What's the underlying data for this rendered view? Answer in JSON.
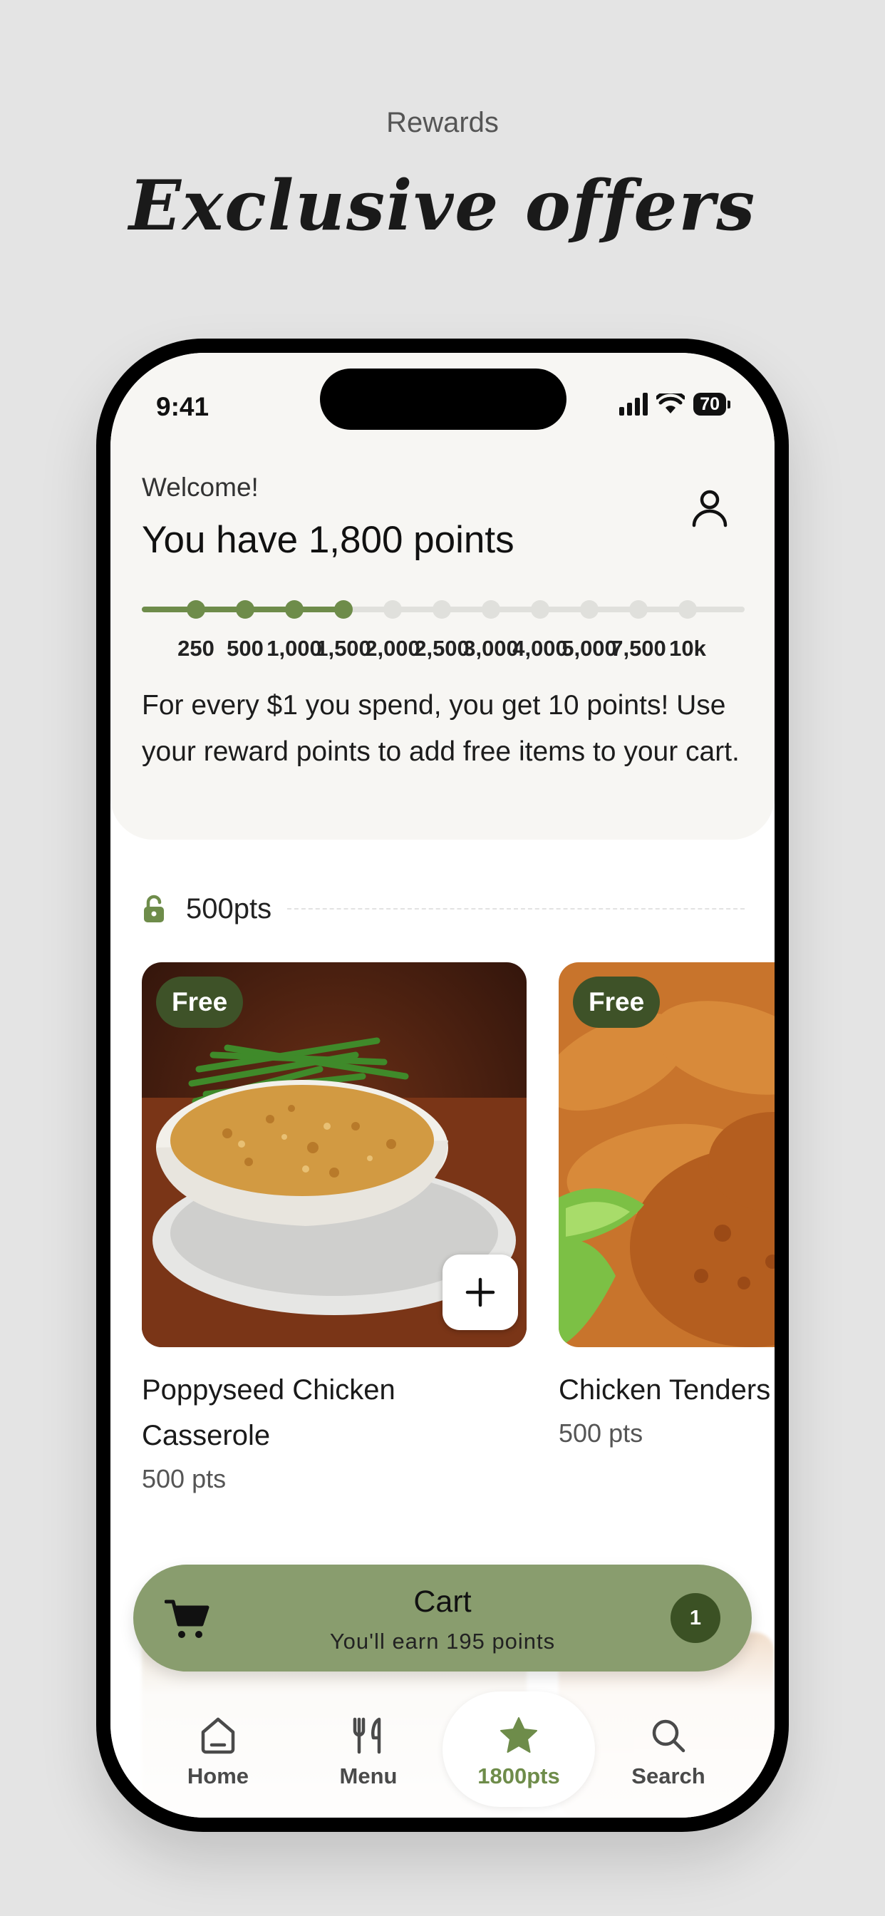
{
  "page": {
    "eyebrow": "Rewards",
    "headline": "Exclusive offers"
  },
  "status_bar": {
    "time": "9:41",
    "battery": "70"
  },
  "header": {
    "welcome": "Welcome!",
    "points_title": "You have 1,800 points"
  },
  "progress": {
    "milestones": [
      "250",
      "500",
      "1,000",
      "1,500",
      "2,000",
      "2,500",
      "3,000",
      "4,000",
      "5,000",
      "7,500",
      "10k"
    ],
    "reached_count": 4
  },
  "info_text": "For every $1 you spend, you get 10 points! Use your reward points to add free items to your cart.",
  "tier": {
    "label": "500pts",
    "icon": "lock-open-icon"
  },
  "items": [
    {
      "badge": "Free",
      "name": "Poppyseed Chicken Casserole",
      "points": "500 pts"
    },
    {
      "badge": "Free",
      "name": "Chicken Tenders",
      "points": "500 pts"
    }
  ],
  "cart": {
    "title": "Cart",
    "subtitle": "You'll earn 195 points",
    "count": "1"
  },
  "tabbar": {
    "tabs": [
      {
        "label": "Home",
        "icon": "home-icon"
      },
      {
        "label": "Menu",
        "icon": "utensils-icon"
      },
      {
        "label": "1800pts",
        "icon": "star-icon"
      },
      {
        "label": "Search",
        "icon": "search-icon"
      }
    ]
  },
  "colors": {
    "accent": "#6e8c4a",
    "badge": "#3e5228",
    "cart_bar": "#899d6e",
    "background": "#e4e4e4"
  }
}
